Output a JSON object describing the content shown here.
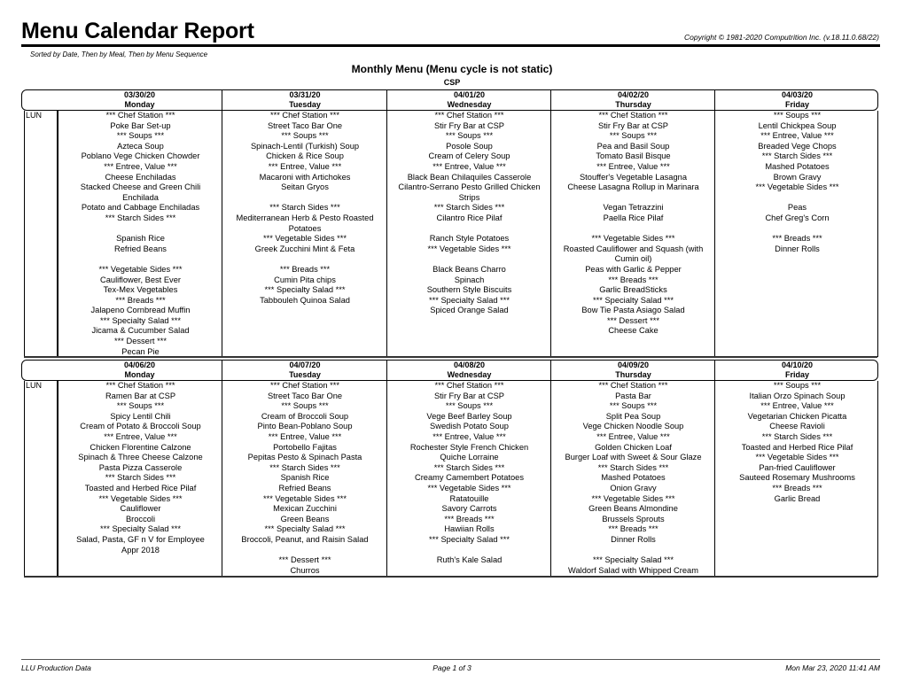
{
  "report": {
    "title": "Menu Calendar Report",
    "copyright": "Copyright © 1981-2020 Computrition Inc. (v.18.11.0.68/22)",
    "sort_note": "Sorted by Date, Then by Meal, Then by Menu Sequence",
    "heading": "Monthly Menu (Menu cycle is not static)",
    "location": "CSP"
  },
  "weeks": [
    {
      "meal": "LUN",
      "days": [
        {
          "date": "03/30/20",
          "weekday": "Monday",
          "lines": [
            "*** Chef Station ***",
            "Poke Bar Set-up",
            "*** Soups ***",
            "Azteca Soup",
            "Poblano Vege Chicken Chowder",
            "*** Entree, Value ***",
            "Cheese Enchiladas",
            "Stacked Cheese and Green Chili",
            "Enchilada",
            "Potato and Cabbage Enchiladas",
            "*** Starch Sides ***",
            "",
            "Spanish Rice",
            "Refried Beans",
            "",
            "*** Vegetable Sides ***",
            "Cauliflower, Best Ever",
            "Tex-Mex Vegetables",
            "*** Breads ***",
            "Jalapeno Cornbread Muffin",
            "*** Specialty Salad ***",
            "Jicama & Cucumber Salad",
            "*** Dessert ***",
            "Pecan Pie"
          ]
        },
        {
          "date": "03/31/20",
          "weekday": "Tuesday",
          "lines": [
            "*** Chef Station ***",
            "Street Taco Bar One",
            "*** Soups ***",
            "Spinach-Lentil (Turkish) Soup",
            "Chicken & Rice Soup",
            "*** Entree, Value ***",
            "Macaroni with Artichokes",
            "Seitan Gryos",
            "",
            "*** Starch Sides ***",
            "Mediterranean Herb & Pesto Roasted",
            "Potatoes",
            "*** Vegetable Sides ***",
            "Greek Zucchini Mint & Feta",
            "",
            "*** Breads ***",
            "Cumin Pita chips",
            "*** Specialty Salad ***",
            "Tabbouleh Quinoa Salad"
          ]
        },
        {
          "date": "04/01/20",
          "weekday": "Wednesday",
          "lines": [
            "*** Chef Station ***",
            "Stir Fry Bar at CSP",
            "*** Soups ***",
            "Posole Soup",
            "Cream of Celery Soup",
            "*** Entree, Value ***",
            "Black Bean Chilaquiles Casserole",
            "Cilantro-Serrano Pesto Grilled Chicken",
            "Strips",
            "*** Starch Sides ***",
            "Cilantro Rice Pilaf",
            "",
            "Ranch Style Potatoes",
            "*** Vegetable Sides ***",
            "",
            "Black Beans Charro",
            "Spinach",
            "Southern Style Biscuits",
            "*** Specialty Salad ***",
            "Spiced Orange Salad"
          ]
        },
        {
          "date": "04/02/20",
          "weekday": "Thursday",
          "lines": [
            "*** Chef Station ***",
            "Stir Fry Bar at CSP",
            "*** Soups ***",
            "Pea and Basil Soup",
            "Tomato Basil Bisque",
            "*** Entree, Value ***",
            "Stouffer's Vegetable Lasagna",
            "Cheese Lasagna Rollup in Marinara",
            "",
            "Vegan Tetrazzini",
            "Paella Rice Pilaf",
            "",
            "*** Vegetable Sides ***",
            "Roasted Cauliflower and Squash (with",
            "Cumin oil)",
            "Peas with Garlic &  Pepper",
            "*** Breads ***",
            "Garlic BreadSticks",
            "*** Specialty Salad ***",
            "Bow Tie Pasta Asiago Salad",
            "*** Dessert ***",
            "Cheese Cake"
          ]
        },
        {
          "date": "04/03/20",
          "weekday": "Friday",
          "lines": [
            "*** Soups ***",
            "Lentil Chickpea Soup",
            "*** Entree, Value ***",
            "Breaded Vege Chops",
            "*** Starch Sides ***",
            "Mashed Potatoes",
            "Brown Gravy",
            "*** Vegetable Sides ***",
            "",
            "Peas",
            "Chef Greg's Corn",
            "",
            "*** Breads ***",
            "Dinner Rolls"
          ]
        }
      ]
    },
    {
      "meal": "LUN",
      "days": [
        {
          "date": "04/06/20",
          "weekday": "Monday",
          "lines": [
            "*** Chef Station ***",
            "Ramen Bar at CSP",
            "*** Soups ***",
            "Spicy Lentil Chili",
            "Cream of Potato & Broccoli Soup",
            "*** Entree, Value ***",
            "Chicken Florentine Calzone",
            "Spinach & Three Cheese Calzone",
            "Pasta Pizza Casserole",
            "*** Starch Sides ***",
            "Toasted and Herbed Rice Pilaf",
            "*** Vegetable Sides ***",
            "Cauliflower",
            "Broccoli",
            "*** Specialty Salad ***",
            "Salad, Pasta, GF n V for Employee",
            "Appr 2018"
          ]
        },
        {
          "date": "04/07/20",
          "weekday": "Tuesday",
          "lines": [
            "*** Chef Station ***",
            "Street Taco Bar One",
            "*** Soups ***",
            "Cream of Broccoli Soup",
            "Pinto Bean-Poblano Soup",
            "*** Entree, Value ***",
            "Portobello Fajitas",
            "Pepitas Pesto & Spinach Pasta",
            "*** Starch Sides ***",
            "Spanish Rice",
            "Refried Beans",
            "*** Vegetable Sides ***",
            "Mexican Zucchini",
            "Green Beans",
            "*** Specialty Salad ***",
            "Broccoli, Peanut, and Raisin Salad",
            "",
            "*** Dessert ***",
            "Churros"
          ]
        },
        {
          "date": "04/08/20",
          "weekday": "Wednesday",
          "lines": [
            "*** Chef Station ***",
            "Stir Fry Bar at CSP",
            "*** Soups ***",
            "Vege Beef Barley Soup",
            "Swedish Potato Soup",
            "*** Entree, Value ***",
            "Rochester Style French Chicken",
            "Quiche Lorraine",
            "*** Starch Sides ***",
            "Creamy Camembert Potatoes",
            "*** Vegetable Sides ***",
            "Ratatouille",
            "Savory Carrots",
            "*** Breads ***",
            "Hawiian Rolls",
            "*** Specialty Salad ***",
            "",
            "Ruth's Kale Salad"
          ]
        },
        {
          "date": "04/09/20",
          "weekday": "Thursday",
          "lines": [
            "*** Chef Station ***",
            "Pasta Bar",
            "*** Soups ***",
            "Split Pea Soup",
            "Vege Chicken Noodle Soup",
            "*** Entree, Value ***",
            "Golden Chicken Loaf",
            "Burger Loaf with Sweet & Sour Glaze",
            "*** Starch Sides ***",
            "Mashed Potatoes",
            "Onion Gravy",
            "*** Vegetable Sides ***",
            "Green Beans Almondine",
            "Brussels Sprouts",
            "*** Breads ***",
            "Dinner Rolls",
            "",
            "*** Specialty Salad ***",
            "Waldorf  Salad with Whipped Cream"
          ]
        },
        {
          "date": "04/10/20",
          "weekday": "Friday",
          "lines": [
            "*** Soups ***",
            "Italian Orzo Spinach Soup",
            "*** Entree, Value ***",
            "Vegetarian Chicken Picatta",
            "Cheese Ravioli",
            "*** Starch Sides ***",
            "Toasted and Herbed Rice Pilaf",
            "*** Vegetable Sides ***",
            "Pan-fried Cauliflower",
            "Sauteed Rosemary Mushrooms",
            "*** Breads ***",
            "Garlic Bread"
          ]
        }
      ]
    }
  ],
  "footer": {
    "left": "LLU Production Data",
    "center": "Page 1 of 3",
    "right": "Mon Mar 23, 2020 11:41 AM"
  }
}
